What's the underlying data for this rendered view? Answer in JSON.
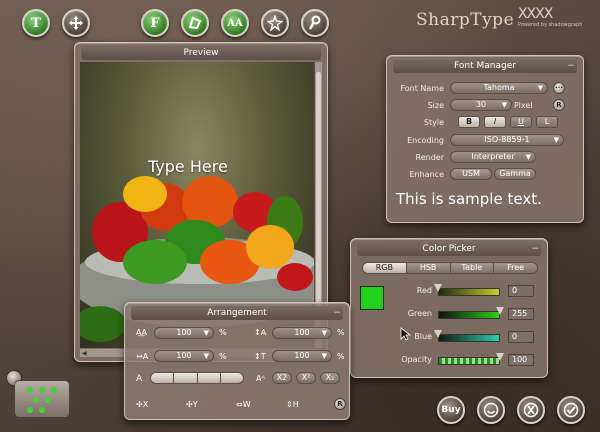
{
  "logo": {
    "text": "SharpType",
    "brand_mark": "XXXX",
    "brand_sub": "Powered by shadowgraph"
  },
  "toolbar": {
    "left": [
      "T",
      "move"
    ],
    "middle": [
      "F",
      "shape",
      "AA",
      "star",
      "wrench"
    ]
  },
  "preview": {
    "title": "Preview",
    "overlay_text": "Type Here"
  },
  "font_manager": {
    "title": "Font Manager",
    "font_name_label": "Font Name",
    "font_name": "Tahoma",
    "size_label": "Size",
    "size": "30",
    "size_unit": "Pixel",
    "r_button": "R",
    "style_label": "Style",
    "styles": [
      "B",
      "I",
      "U",
      "L"
    ],
    "encoding_label": "Encoding",
    "encoding": "ISO-8859-1",
    "render_label": "Render",
    "render": "Interpreter",
    "enhance_label": "Enhance",
    "enhance": [
      "USM",
      "Gamma"
    ],
    "sample_text": "This is sample text."
  },
  "color_picker": {
    "title": "Color Picker",
    "tabs": [
      "RGB",
      "HSB",
      "Table",
      "Free"
    ],
    "swatch_color": "#22d11a",
    "red_label": "Red",
    "red": "0",
    "green_label": "Green",
    "green": "255",
    "blue_label": "Blue",
    "blue": "0",
    "opacity_label": "Opacity",
    "opacity": "100"
  },
  "arrangement": {
    "title": "Arrangement",
    "v1": "100",
    "v2": "100",
    "v3": "100",
    "v4": "100",
    "unit": "%",
    "script_buttons": [
      "X2",
      "X²",
      "X₂"
    ],
    "bottom": [
      "X",
      "Y",
      "W",
      "H",
      "R"
    ]
  },
  "actions": {
    "buy": "Buy"
  }
}
